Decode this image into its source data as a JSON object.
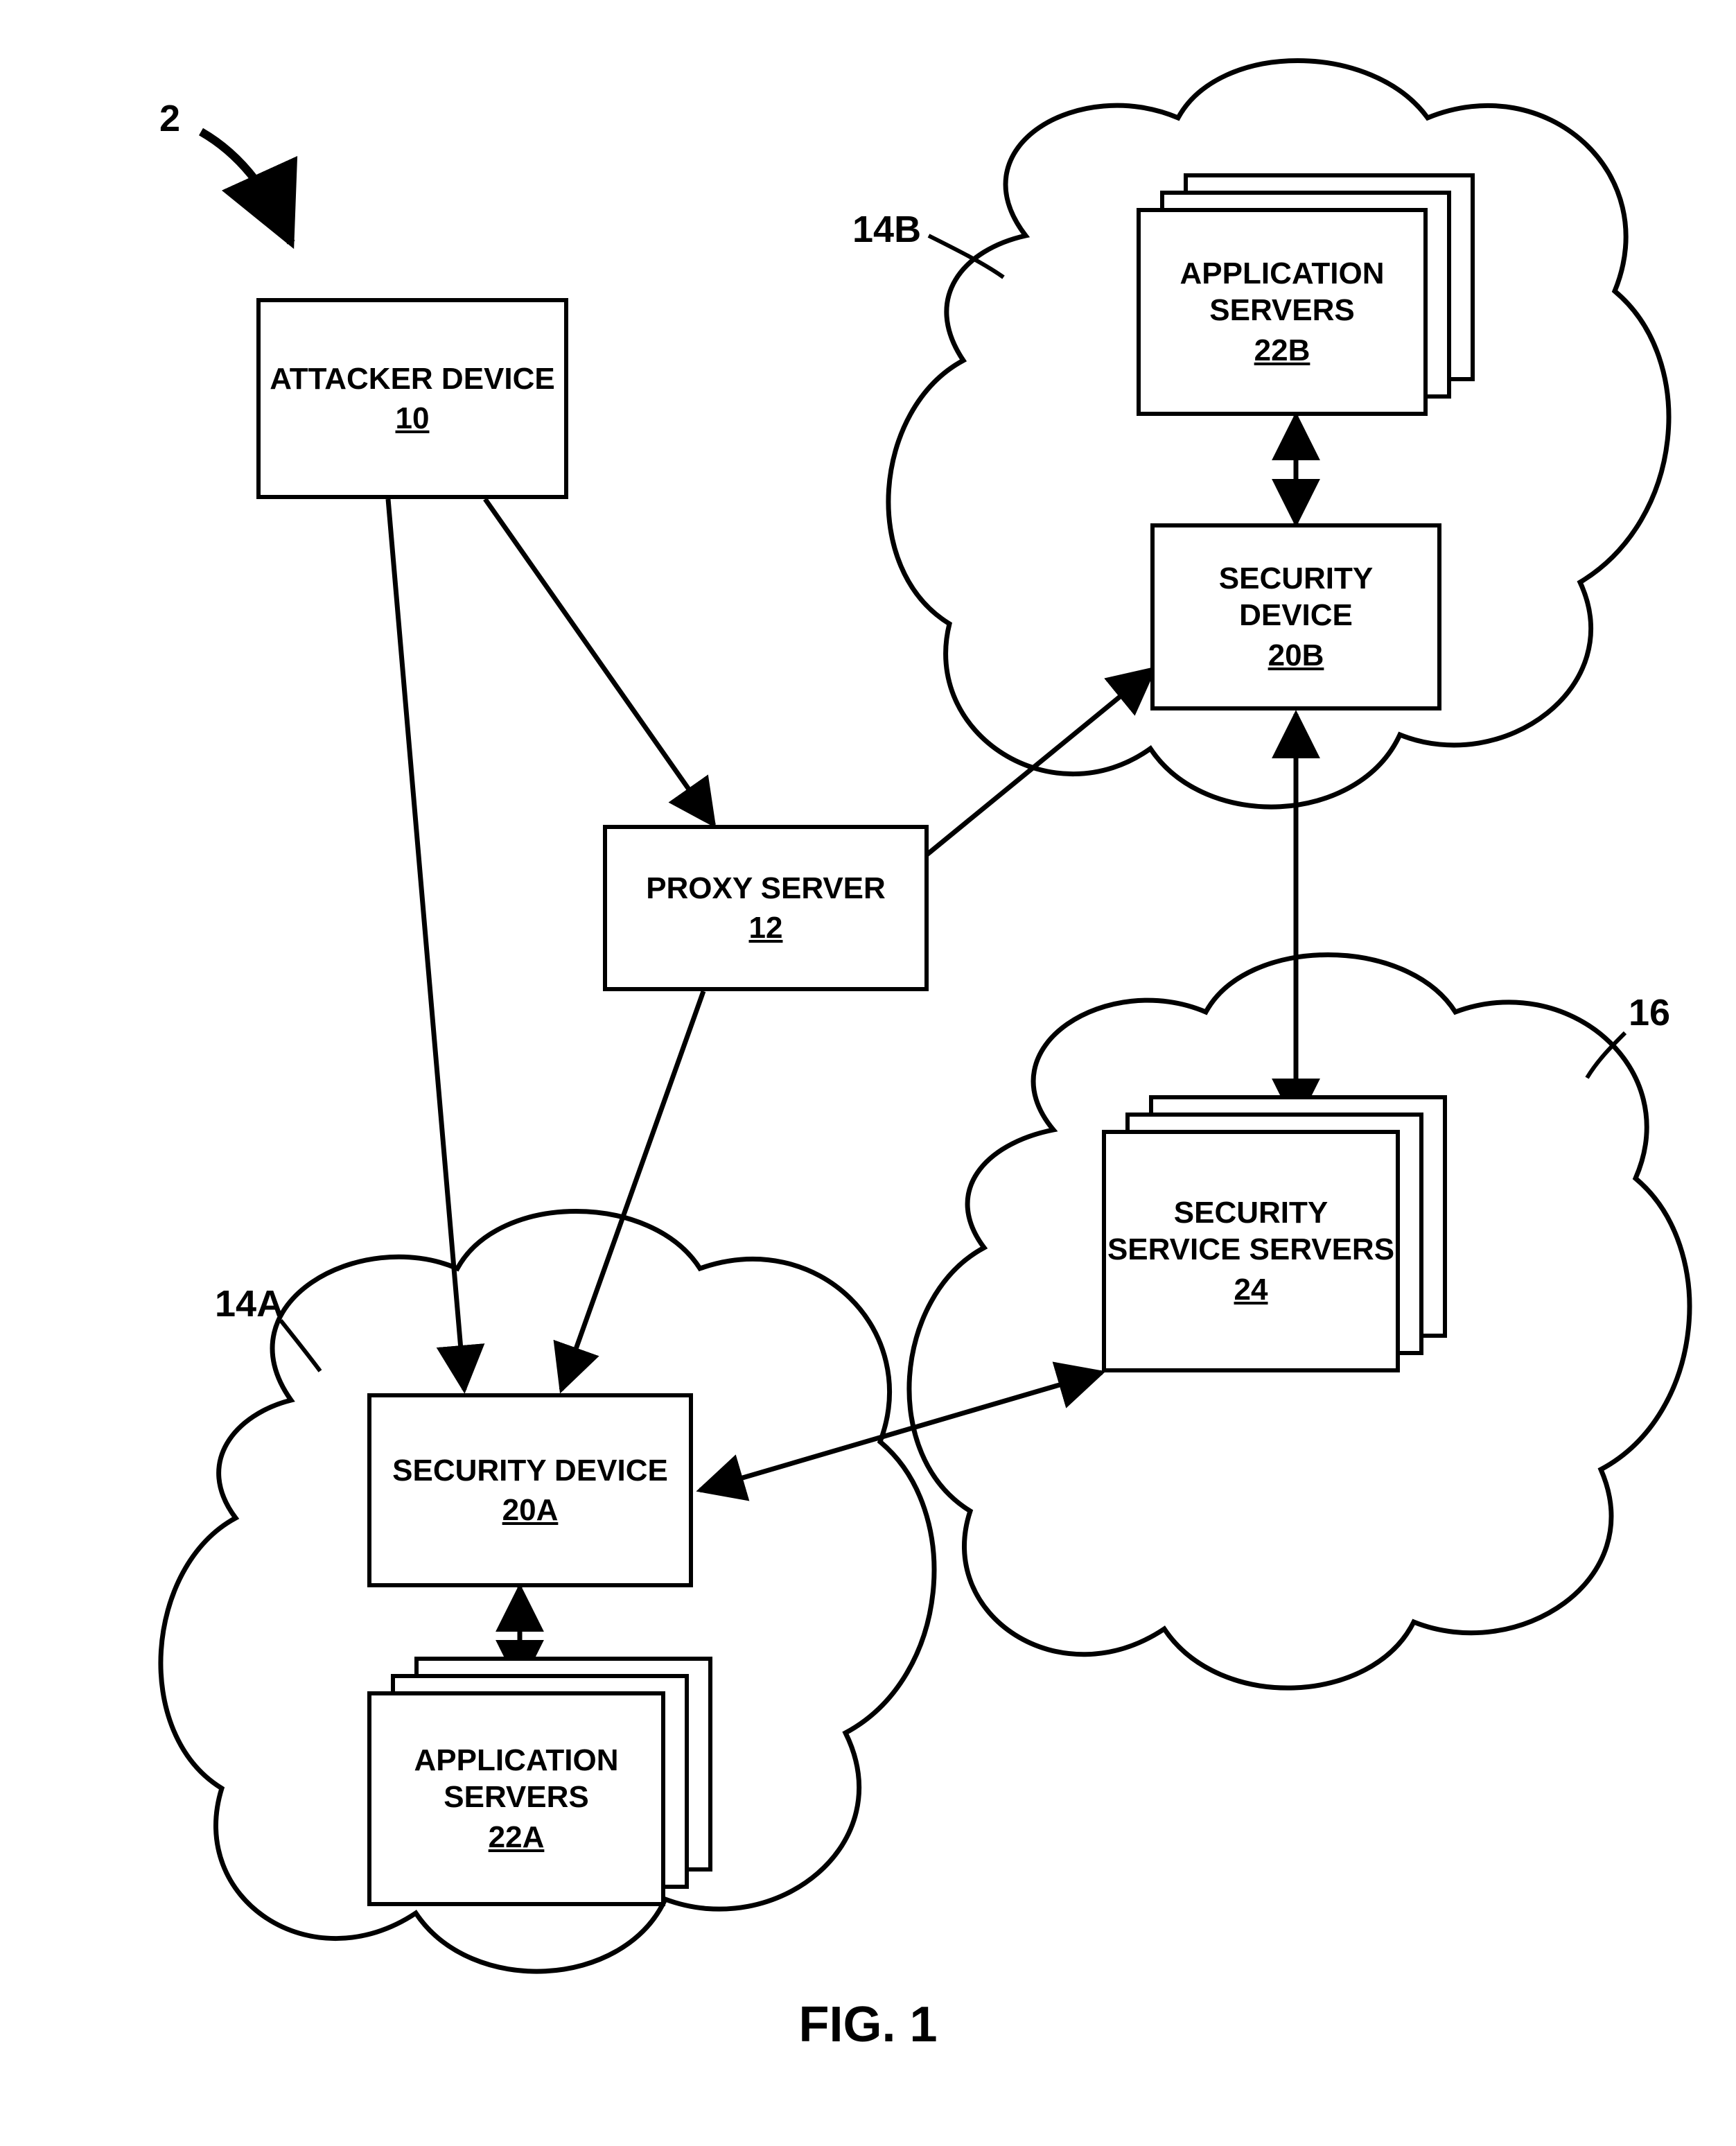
{
  "figure": {
    "ref_main": "2",
    "caption": "FIG. 1"
  },
  "clouds": {
    "a_label": "14A",
    "b_label": "14B",
    "c_label": "16"
  },
  "attacker": {
    "title": "ATTACKER DEVICE",
    "ref": "10"
  },
  "proxy": {
    "title": "PROXY SERVER",
    "ref": "12"
  },
  "sec_a": {
    "title": "SECURITY DEVICE",
    "ref": "20A"
  },
  "sec_b": {
    "title": "SECURITY DEVICE",
    "ref": "20B"
  },
  "apps_a": {
    "title": "APPLICATION SERVERS",
    "ref": "22A"
  },
  "apps_b": {
    "title": "APPLICATION SERVERS",
    "ref": "22B"
  },
  "svc": {
    "title": "SECURITY SERVICE SERVERS",
    "ref": "24"
  }
}
